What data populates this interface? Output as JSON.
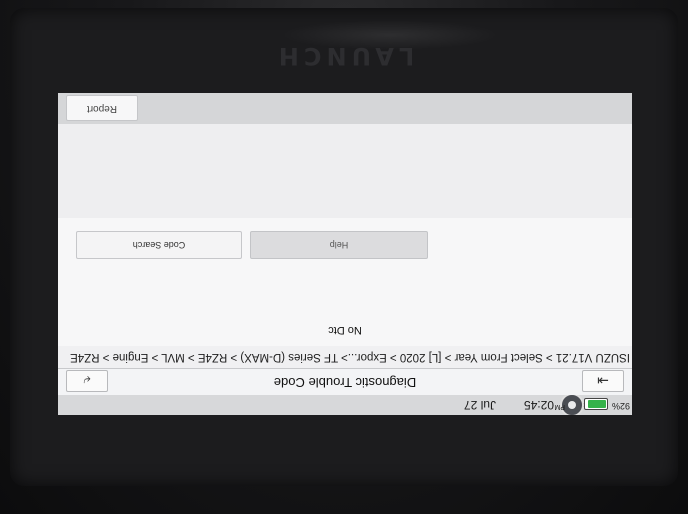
{
  "device": {
    "brand": "LAUNCH"
  },
  "status_bar": {
    "date": "Jul 27",
    "time": "02:45",
    "ampm": "PM",
    "battery_percent": "92%",
    "battery_level": 0.92,
    "battery_color": "#35b24a",
    "camera_icon": "camera-icon"
  },
  "title_bar": {
    "title": "Diagnostic Trouble Code",
    "exit_icon": "exit-icon",
    "back_icon": "back-arrow-icon"
  },
  "breadcrumb": "ISUZU V17.21 > Select From Year > [L] 2020 > Expor...> TF Series (D-MAX) > RZ4E > MVL > Engine > RZ4E",
  "panel": {
    "message": "No Dtc",
    "code_search_label": "Code Search",
    "help_label": "Help"
  },
  "footer": {
    "report_label": "Report"
  }
}
